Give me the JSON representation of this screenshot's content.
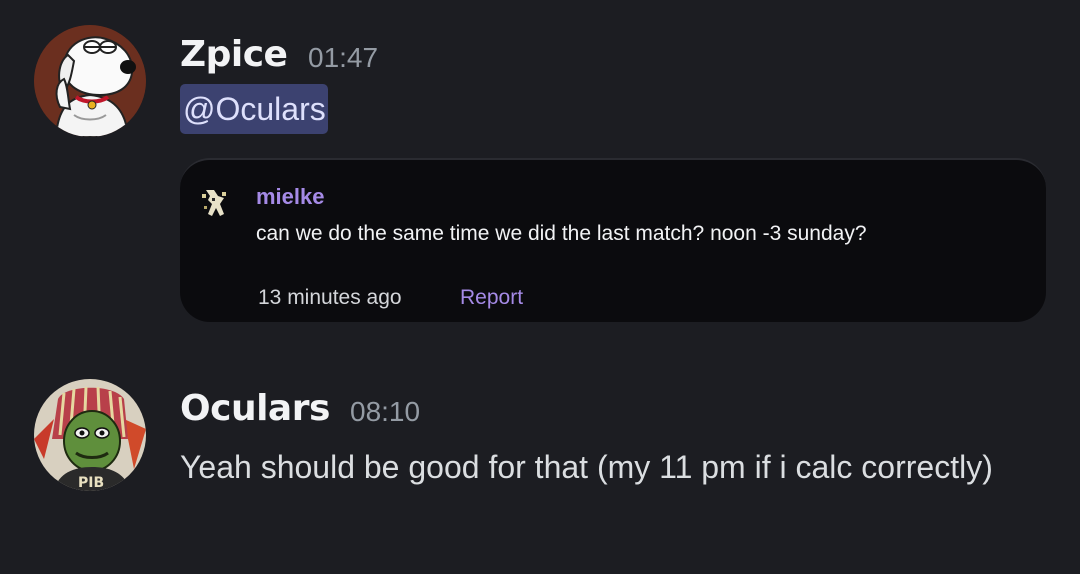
{
  "messages": [
    {
      "author": "Zpice",
      "timestamp": "01:47",
      "mention": "@Oculars",
      "embed": {
        "author": "mielke",
        "text": "can we do the same time we did the last match? noon -3 sunday?",
        "time_ago": "13 minutes ago",
        "action": "Report"
      }
    },
    {
      "author": "Oculars",
      "timestamp": "08:10",
      "text": "Yeah should be good for that (my 11 pm if i calc correctly)"
    }
  ],
  "colors": {
    "background": "#1c1d22",
    "embed_background": "#0b0b0e",
    "mention_background": "#3c4270",
    "link_purple": "#a58ae6",
    "timestamp_gray": "#949ba4"
  },
  "icons": {
    "avatar_1": "cartoon-dog-avatar",
    "avatar_2": "green-face-dreadlocks-avatar",
    "embed_icon": "pixel-figure-icon"
  }
}
